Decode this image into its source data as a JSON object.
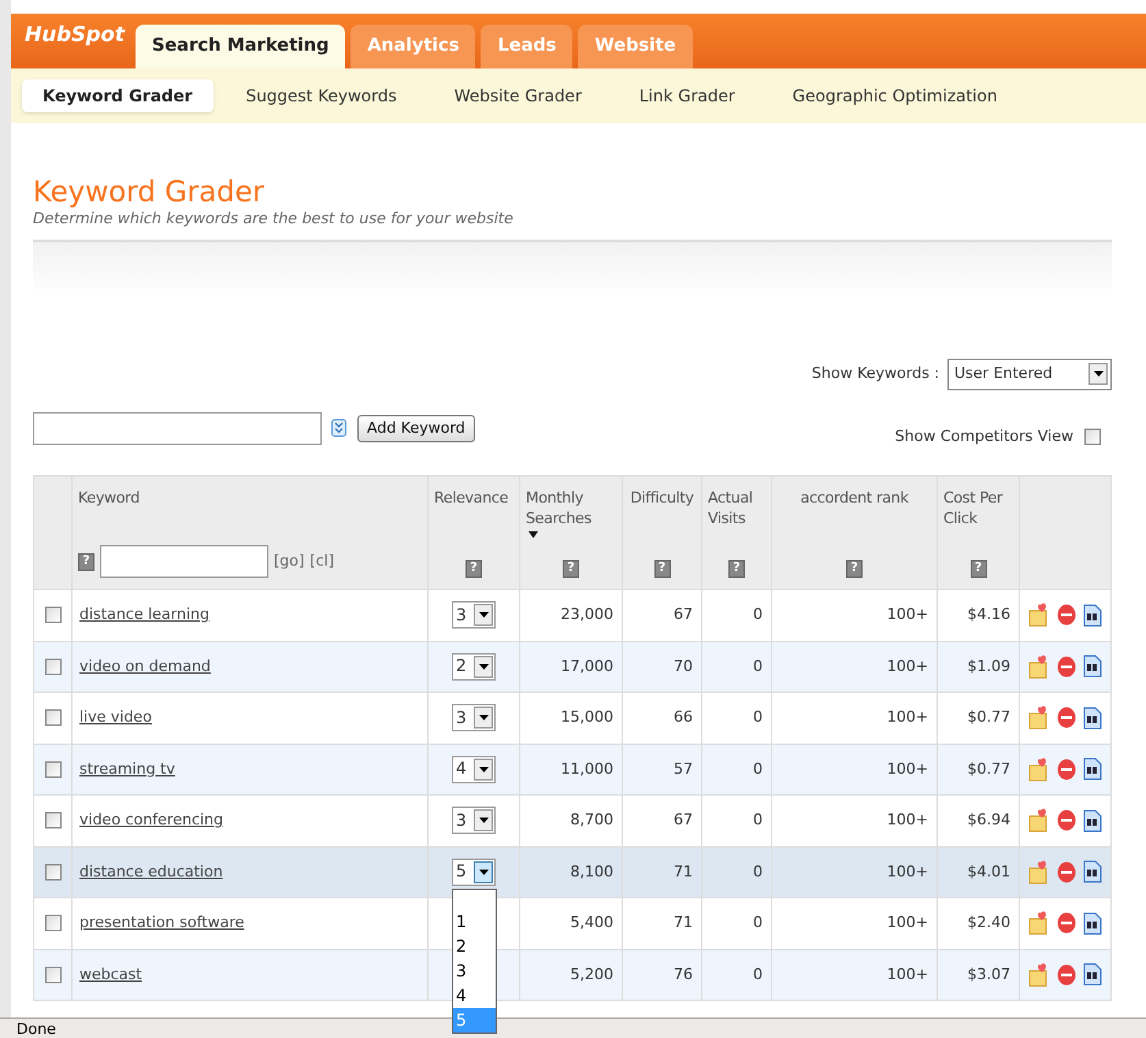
{
  "logo": "HubSpot",
  "tabs": [
    {
      "label": "Search Marketing",
      "selected": true
    },
    {
      "label": "Analytics",
      "selected": false
    },
    {
      "label": "Leads",
      "selected": false
    },
    {
      "label": "Website",
      "selected": false
    }
  ],
  "subtabs": [
    {
      "label": "Keyword Grader",
      "selected": true
    },
    {
      "label": "Suggest Keywords",
      "selected": false
    },
    {
      "label": "Website Grader",
      "selected": false
    },
    {
      "label": "Link Grader",
      "selected": false
    },
    {
      "label": "Geographic Optimization",
      "selected": false
    }
  ],
  "page_title": "Keyword Grader",
  "page_subtitle": "Determine which keywords are the best to use for your website",
  "show_keywords": {
    "label": "Show Keywords :",
    "value": "User Entered"
  },
  "add_keyword_button": "Add Keyword",
  "competitors_view": {
    "label": "Show Competitors View",
    "checked": false
  },
  "columns": [
    {
      "label": "Keyword",
      "help": "?",
      "filter_links": [
        "[go]",
        "[cl]"
      ]
    },
    {
      "label": "Relevance",
      "help": "?"
    },
    {
      "label": "Monthly Searches",
      "help": "?",
      "sorted": true
    },
    {
      "label": "Difficulty",
      "help": "?"
    },
    {
      "label": "Actual Visits",
      "help": "?"
    },
    {
      "label": "accordent rank",
      "help": "?"
    },
    {
      "label": "Cost Per Click",
      "help": "?"
    }
  ],
  "rows": [
    {
      "keyword": "distance learning",
      "relevance": "3",
      "menu_open": false,
      "selected": false,
      "checked": false,
      "searches": "23,000",
      "difficulty": "67",
      "visits": "0",
      "rank": "100+",
      "cpc": "$4.16"
    },
    {
      "keyword": "video on demand",
      "relevance": "2",
      "menu_open": false,
      "selected": false,
      "checked": false,
      "searches": "17,000",
      "difficulty": "70",
      "visits": "0",
      "rank": "100+",
      "cpc": "$1.09"
    },
    {
      "keyword": "live video",
      "relevance": "3",
      "menu_open": false,
      "selected": false,
      "checked": false,
      "searches": "15,000",
      "difficulty": "66",
      "visits": "0",
      "rank": "100+",
      "cpc": "$0.77"
    },
    {
      "keyword": "streaming tv",
      "relevance": "4",
      "menu_open": false,
      "selected": false,
      "checked": false,
      "searches": "11,000",
      "difficulty": "57",
      "visits": "0",
      "rank": "100+",
      "cpc": "$0.77"
    },
    {
      "keyword": "video conferencing",
      "relevance": "3",
      "menu_open": false,
      "selected": false,
      "checked": false,
      "searches": "8,700",
      "difficulty": "67",
      "visits": "0",
      "rank": "100+",
      "cpc": "$6.94"
    },
    {
      "keyword": "distance education",
      "relevance": "5",
      "menu_open": true,
      "selected": true,
      "checked": false,
      "searches": "8,100",
      "difficulty": "71",
      "visits": "0",
      "rank": "100+",
      "cpc": "$4.01"
    },
    {
      "keyword": "presentation software",
      "selected": false,
      "checked": false,
      "searches": "5,400",
      "difficulty": "71",
      "visits": "0",
      "rank": "100+",
      "cpc": "$2.40"
    },
    {
      "keyword": "webcast",
      "selected": false,
      "checked": false,
      "searches": "5,200",
      "difficulty": "76",
      "visits": "0",
      "rank": "100+",
      "cpc": "$3.07"
    }
  ],
  "relevance_options": [
    {
      "label": "1",
      "selected": false
    },
    {
      "label": "2",
      "selected": false
    },
    {
      "label": "3",
      "selected": false
    },
    {
      "label": "4",
      "selected": false
    },
    {
      "label": "5",
      "selected": true
    }
  ],
  "status_bar": "Done"
}
